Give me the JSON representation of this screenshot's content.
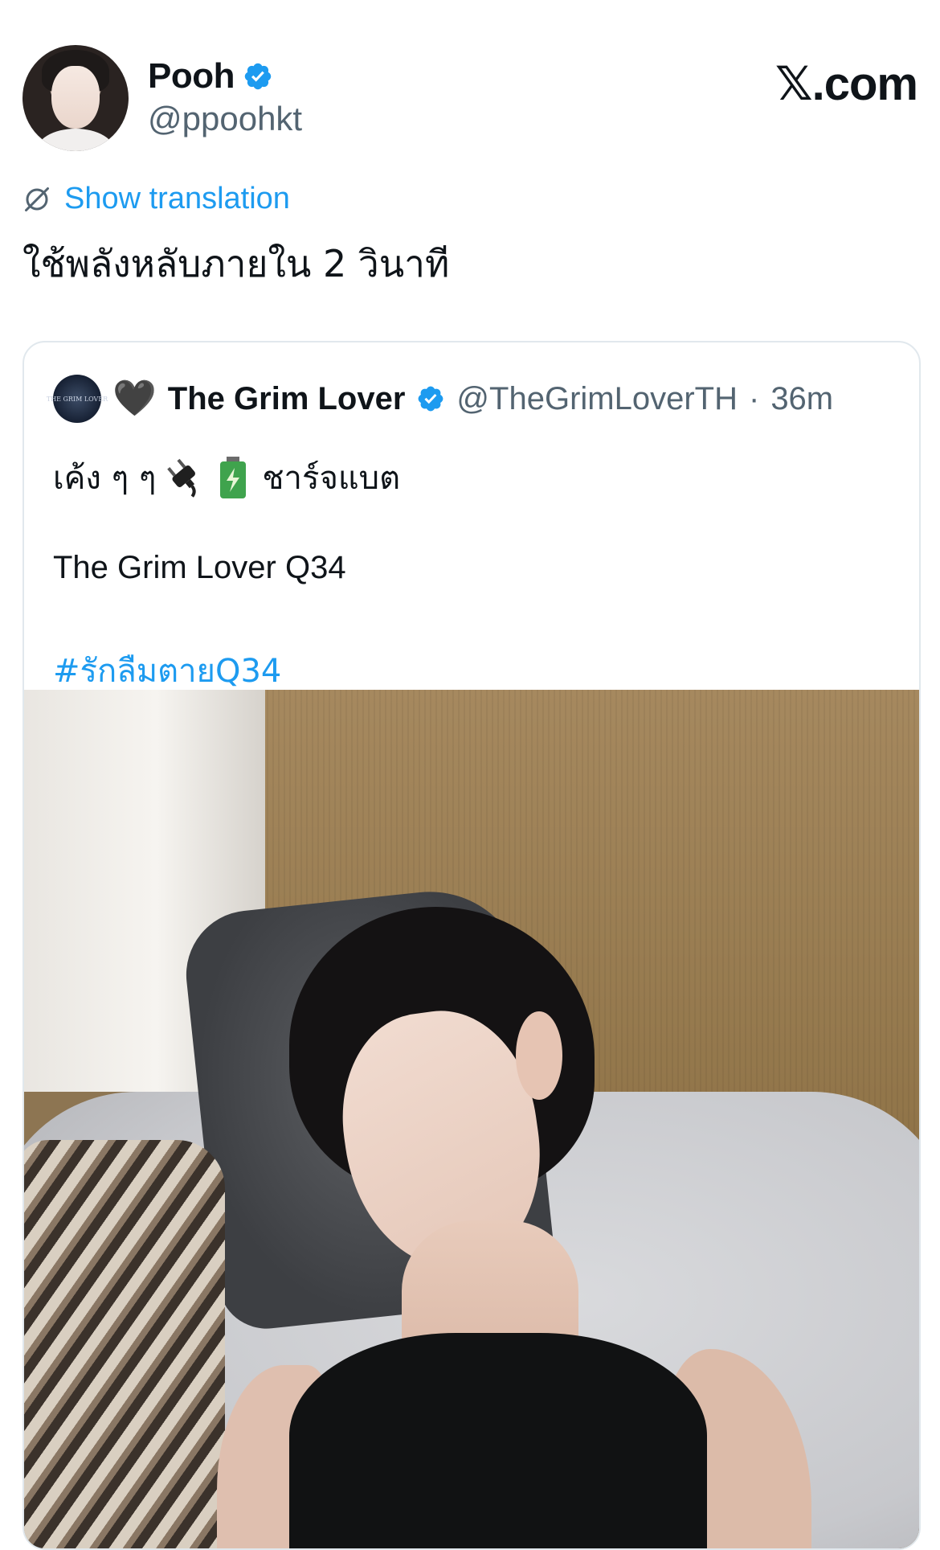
{
  "author": {
    "name": "Pooh",
    "handle": "@ppoohkt",
    "verified": true
  },
  "brand": {
    "logo_text": "𝕏.com"
  },
  "translation": {
    "label": "Show translation"
  },
  "tweet": {
    "text": "ใช้พลังหลับภายใน 2 วินาที"
  },
  "quoted_tweet": {
    "author_emoji": "🖤",
    "author_name": "The Grim Lover",
    "verified": true,
    "handle": "@TheGrimLoverTH",
    "separator": "·",
    "time": "36m",
    "line1_text_a": "เค้ง ๆ ๆ",
    "line1_text_b": "ชาร์จแบต",
    "line2": "The Grim Lover Q34",
    "hashtag": "#รักลืมตายQ34",
    "avatar_text": "THE GRIM LOVER",
    "media_icons": [
      "plug-icon",
      "battery-icon"
    ]
  },
  "colors": {
    "accent": "#1d9bf0",
    "text": "#0f1419",
    "muted": "#536471",
    "border": "#e1e8ed"
  }
}
